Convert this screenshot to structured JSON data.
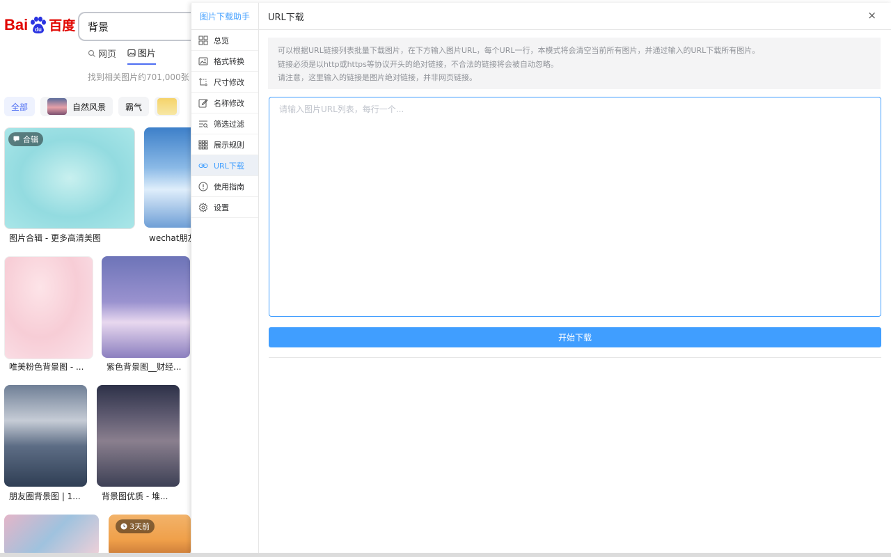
{
  "baidu": {
    "logo_text": "Bai",
    "logo_du": "du",
    "logo_cn": "百度",
    "search_value": "背景",
    "tabs": [
      {
        "label": "网页",
        "icon": "search-icon"
      },
      {
        "label": "图片",
        "icon": "image-icon"
      }
    ],
    "result_count": "找到相关图片约701,000张",
    "filters": [
      "全部",
      "自然风景",
      "霸气"
    ],
    "images": [
      {
        "caption": "图片合辑 - 更多高清美图",
        "badge": "合辑"
      },
      {
        "caption": "wechat朋友"
      },
      {
        "caption": "唯美粉色背景图 - ..."
      },
      {
        "caption": "紫色背景图__财经..."
      },
      {
        "caption": "朋友圈背景图 | 1..."
      },
      {
        "caption": "背景图优质 - 堆..."
      },
      {
        "caption": "",
        "badge": "3天前"
      }
    ]
  },
  "panel": {
    "brand": "图片下载助手",
    "title": "URL下载",
    "close_label": "×",
    "nav": [
      {
        "label": "总览",
        "icon": "grid-icon"
      },
      {
        "label": "格式转换",
        "icon": "image-icon"
      },
      {
        "label": "尺寸修改",
        "icon": "crop-icon"
      },
      {
        "label": "名称修改",
        "icon": "edit-icon"
      },
      {
        "label": "筛选过滤",
        "icon": "filter-icon"
      },
      {
        "label": "展示规则",
        "icon": "apps-icon"
      },
      {
        "label": "URL下载",
        "icon": "link-icon",
        "active": true
      },
      {
        "label": "使用指南",
        "icon": "info-icon"
      },
      {
        "label": "设置",
        "icon": "gear-icon"
      }
    ],
    "notice": [
      "可以根据URL链接列表批量下载图片，在下方输入图片URL，每个URL一行，本模式将会清空当前所有图片，并通过输入的URL下载所有图片。",
      "链接必须是以http或https等协议开头的绝对链接，不合法的链接将会被自动忽略。",
      "请注意，这里输入的链接是图片绝对链接，并非网页链接。"
    ],
    "textarea_placeholder": "请输入图片URL列表，每行一个...",
    "textarea_value": "",
    "start_button": "开始下载",
    "accent_color": "#409eff"
  }
}
